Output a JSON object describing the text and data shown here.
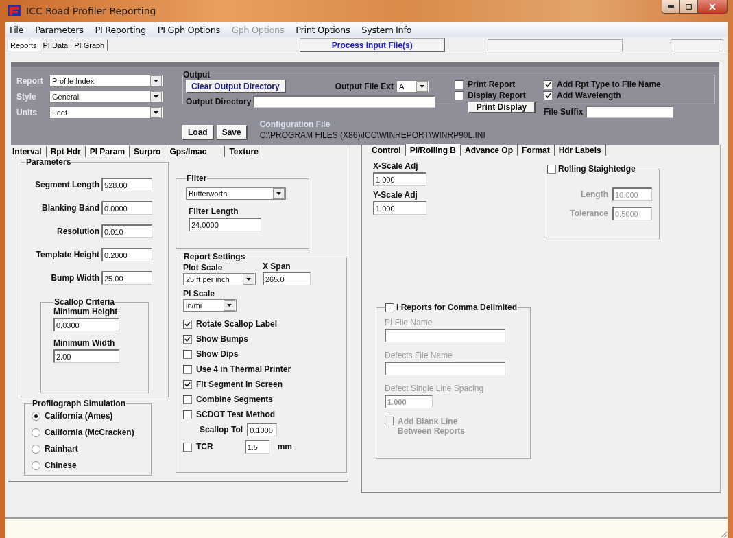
{
  "window": {
    "title": "ICC Road Profiler Reporting"
  },
  "menu": [
    {
      "label": "File",
      "disabled": false
    },
    {
      "label": "Parameters",
      "disabled": false
    },
    {
      "label": "PI Reporting",
      "disabled": false
    },
    {
      "label": "PI Gph Options",
      "disabled": false
    },
    {
      "label": "Gph Options",
      "disabled": true
    },
    {
      "label": "Print Options",
      "disabled": false
    },
    {
      "label": "System Info",
      "disabled": false
    }
  ],
  "top_tabs": [
    {
      "label": "Reports",
      "selected": true
    },
    {
      "label": "PI Data",
      "selected": false
    },
    {
      "label": "PI Graph",
      "selected": false
    }
  ],
  "process_button": "Process Input File(s)",
  "config": {
    "selects": [
      {
        "label": "Report",
        "value": "Profile Index"
      },
      {
        "label": "Style",
        "value": "General"
      },
      {
        "label": "Units",
        "value": "Feet"
      }
    ],
    "output": {
      "title": "Output",
      "clear_button": "Clear Output Directory",
      "ext_label": "Output File Ext",
      "ext_value": "A",
      "dir_label": "Output Directory",
      "print_checks": [
        {
          "label": "Print Report",
          "checked": false
        },
        {
          "label": "Display Report",
          "checked": false
        }
      ],
      "print_display_button": "Print Display",
      "name_checks": [
        {
          "label": "Add Rpt Type to File Name",
          "checked": true
        },
        {
          "label": "Add Wavelength",
          "checked": true
        }
      ],
      "suffix_label": "File Suffix"
    },
    "buttons": [
      "Load",
      "Save"
    ],
    "config_file": {
      "label": "Configuration File",
      "path": "C:\\PROGRAM FILES (X86)\\ICC\\WINREPORT\\WINRP90L.INI"
    }
  },
  "left_tabs": [
    {
      "label": "Interval",
      "selected": false
    },
    {
      "label": "Rpt Hdr",
      "selected": false
    },
    {
      "label": "PI Param",
      "selected": true
    },
    {
      "label": "Surpro",
      "selected": false
    },
    {
      "label": "Gps/Imac",
      "selected": false
    },
    {
      "label": "Texture",
      "selected": false
    }
  ],
  "right_tabs": [
    {
      "label": "Control",
      "selected": false
    },
    {
      "label": "PI/Rolling B",
      "selected": true
    },
    {
      "label": "Advance Op",
      "selected": false
    },
    {
      "label": "Format",
      "selected": false
    },
    {
      "label": "Hdr Labels",
      "selected": false
    }
  ],
  "parameters": {
    "title": "Parameters",
    "fields": [
      {
        "label": "Segment Length",
        "value": "528.00"
      },
      {
        "label": "Blanking Band",
        "value": "0.0000"
      },
      {
        "label": "Resolution",
        "value": "0.010"
      },
      {
        "label": "Template Height",
        "value": "0.2000"
      },
      {
        "label": "Bump Width",
        "value": "25.00"
      }
    ],
    "scallop": {
      "title": "Scallop Criteria",
      "fields": [
        {
          "label": "Minimum Height",
          "value": "0.0300"
        },
        {
          "label": "Minimum Width",
          "value": "2.00"
        }
      ]
    }
  },
  "profilograph": {
    "title": "Profilograph Simulation",
    "options": [
      {
        "label": "California (Ames)",
        "selected": true
      },
      {
        "label": "California (McCracken)",
        "selected": false
      },
      {
        "label": "Rainhart",
        "selected": false
      },
      {
        "label": "Chinese",
        "selected": false
      }
    ]
  },
  "filter": {
    "title": "Filter",
    "type": "Butterworth",
    "length_label": "Filter Length",
    "length_value": "24.0000"
  },
  "report_settings": {
    "title": "Report Settings",
    "plot_scale_label": "Plot Scale",
    "plot_scale_value": "25 ft per inch",
    "x_span_label": "X Span",
    "x_span_value": "265.0",
    "pi_scale_label": "PI Scale",
    "pi_scale_value": "in/mi",
    "checks": [
      {
        "label": "Rotate Scallop Label",
        "checked": true
      },
      {
        "label": "Show Bumps",
        "checked": true
      },
      {
        "label": "Show Dips",
        "checked": false
      },
      {
        "label": "Use 4 in Thermal Printer",
        "checked": false
      },
      {
        "label": "Fit Segment in Screen",
        "checked": true
      },
      {
        "label": "Combine Segments",
        "checked": false
      },
      {
        "label": "SCDOT Test Method",
        "checked": false
      }
    ],
    "scallop_tol_label": "Scallop Tol",
    "scallop_tol_value": "0.1000",
    "tcr": {
      "label": "TCR",
      "checked": false,
      "value": "1.5",
      "unit": "mm"
    }
  },
  "scale": [
    {
      "label": "X-Scale Adj",
      "value": "1.000"
    },
    {
      "label": "Y-Scale Adj",
      "value": "1.000"
    }
  ],
  "rolling": {
    "title": "Rolling Staightedge",
    "checked": false,
    "fields": [
      {
        "label": "Length",
        "value": "10.000",
        "disabled": true
      },
      {
        "label": "Tolerance",
        "value": "0.5000",
        "disabled": true
      }
    ]
  },
  "comma": {
    "title": "I Reports for Comma Delimited",
    "checked": false,
    "fields": [
      {
        "label": "PI File Name",
        "disabled": true
      },
      {
        "label": "Defects File Name",
        "disabled": true
      },
      {
        "label": "Defect Single Line Spacing",
        "value": "1.000",
        "disabled": true
      }
    ],
    "blank_line": {
      "label": "Add Blank Line Between Reports",
      "checked": false,
      "disabled": true
    }
  }
}
